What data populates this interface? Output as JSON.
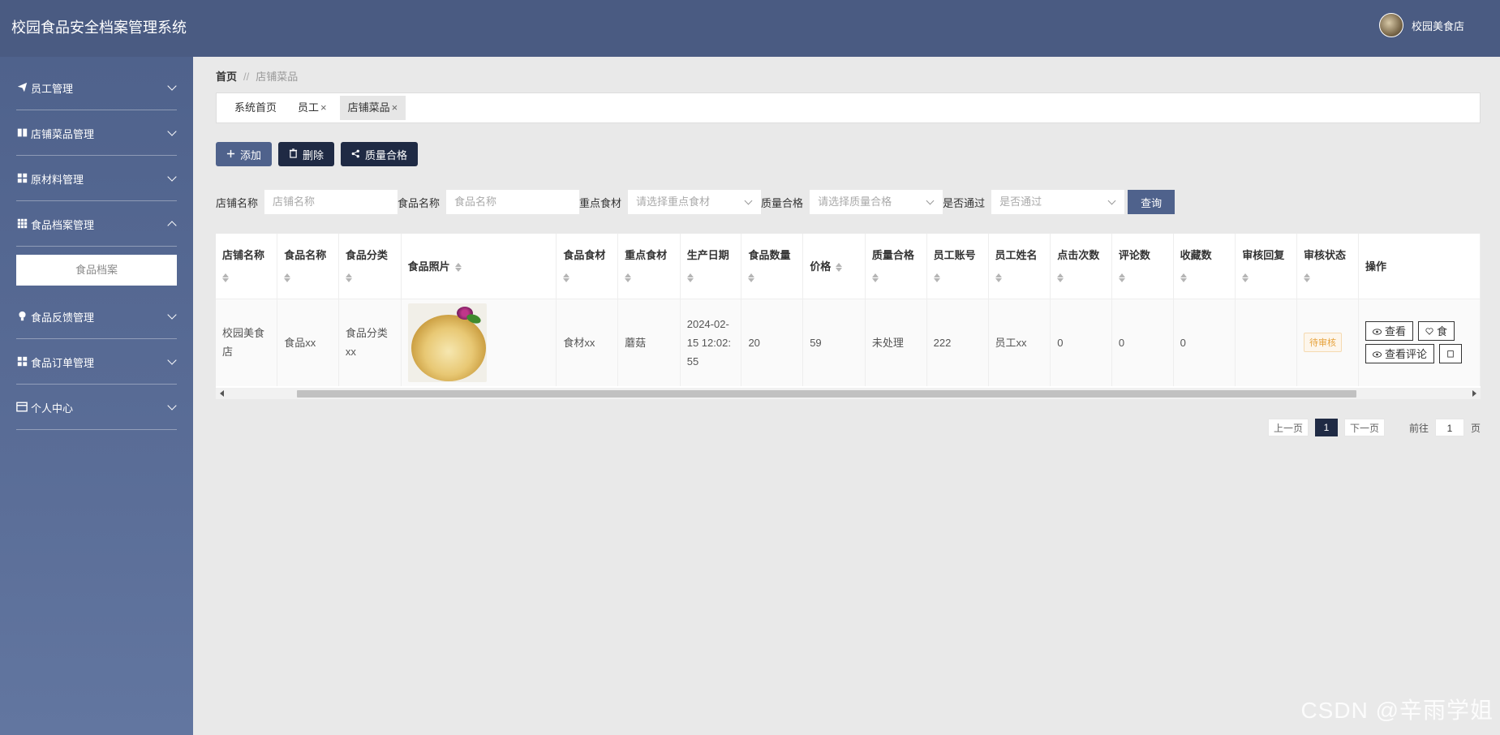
{
  "app": {
    "title": "校园食品安全档案管理系统",
    "user_name": "校园美食店"
  },
  "sidebar": {
    "items": [
      {
        "label": "员工管理",
        "icon": "paper-plane-icon"
      },
      {
        "label": "店铺菜品管理",
        "icon": "book-icon"
      },
      {
        "label": "原材料管理",
        "icon": "grid-icon"
      },
      {
        "label": "食品档案管理",
        "icon": "table-icon",
        "expanded": true,
        "submenu": [
          "食品档案"
        ]
      },
      {
        "label": "食品反馈管理",
        "icon": "bulb-icon"
      },
      {
        "label": "食品订单管理",
        "icon": "grid-icon"
      },
      {
        "label": "个人中心",
        "icon": "card-icon"
      }
    ]
  },
  "breadcrumb": {
    "home": "首页",
    "sep": "//",
    "current": "店铺菜品"
  },
  "tabs": [
    {
      "label": "系统首页",
      "closable": false
    },
    {
      "label": "员工",
      "closable": true
    },
    {
      "label": "店铺菜品",
      "closable": true,
      "active": true
    }
  ],
  "tab_close": "×",
  "actions": {
    "add": "添加",
    "delete": "删除",
    "quality": "质量合格"
  },
  "filters": {
    "shop_label": "店铺名称",
    "shop_placeholder": "店铺名称",
    "food_label": "食品名称",
    "food_placeholder": "食品名称",
    "key_label": "重点食材",
    "key_placeholder": "请选择重点食材",
    "quality_label": "质量合格",
    "quality_placeholder": "请选择质量合格",
    "pass_label": "是否通过",
    "pass_placeholder": "是否通过",
    "query": "查询"
  },
  "table": {
    "columns": [
      "店铺名称",
      "食品名称",
      "食品分类",
      "食品照片",
      "食品食材",
      "重点食材",
      "生产日期",
      "食品数量",
      "价格",
      "质量合格",
      "员工账号",
      "员工姓名",
      "点击次数",
      "评论数",
      "收藏数",
      "审核回复",
      "审核状态",
      "操作"
    ],
    "rows": [
      {
        "shop": "校园美食店",
        "food": "食品xx",
        "category": "食品分类xx",
        "ingredients": "食材xx",
        "key": "蘑菇",
        "date": "2024-02-15 12:02:55",
        "qty": "20",
        "price": "59",
        "quality": "未处理",
        "account": "222",
        "staff": "员工xx",
        "clicks": "0",
        "comments": "0",
        "favorites": "0",
        "reply": "",
        "status": "待审核"
      }
    ],
    "ops": {
      "view": "查看",
      "food": "食",
      "view_comments": "查看评论"
    }
  },
  "pager": {
    "prev": "上一页",
    "page": "1",
    "next": "下一页",
    "goto": "前往",
    "goto_value": "1",
    "unit": "页"
  },
  "watermark": "CSDN @辛雨学姐",
  "colors": {
    "topbar": "#4a5b82",
    "accent": "#4f628c",
    "dark": "#1f2a44",
    "pending": "#e6a23c"
  }
}
